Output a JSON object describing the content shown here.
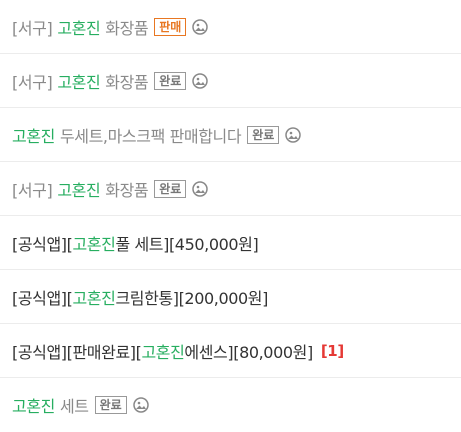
{
  "rows": [
    {
      "prefix": "[서구]",
      "keyword": "고혼진",
      "rest": "화장품",
      "badge": "판매",
      "badge_type": "selling",
      "icon": "image-icon"
    },
    {
      "prefix": "[서구]",
      "keyword": "고혼진",
      "rest": "화장품",
      "badge": "완료",
      "badge_type": "done",
      "icon": "image-icon"
    },
    {
      "keyword": "고혼진",
      "rest": "두세트,마스크팩 판매합니다",
      "badge": "완료",
      "badge_type": "done",
      "icon": "image-icon"
    },
    {
      "prefix": "[서구]",
      "keyword": "고혼진",
      "rest": "화장품",
      "badge": "완료",
      "badge_type": "done",
      "icon": "image-icon"
    },
    {
      "prefix": "[공식앱][",
      "keyword": "고혼진",
      "rest": " 풀 세트][450,000원]"
    },
    {
      "prefix": "[공식앱][",
      "keyword": "고혼진",
      "rest": "크림한통][200,000원]"
    },
    {
      "prefix": "[공식앱][판매완료][",
      "keyword": "고혼진",
      "rest": "에센스][80,000원]",
      "count": "[1]"
    },
    {
      "keyword": "고혼진",
      "rest": "세트",
      "badge": "완료",
      "badge_type": "done",
      "icon": "image-icon"
    }
  ],
  "colors": {
    "keyword": "#27ae60",
    "selling": "#e87722",
    "count": "#e53935"
  }
}
